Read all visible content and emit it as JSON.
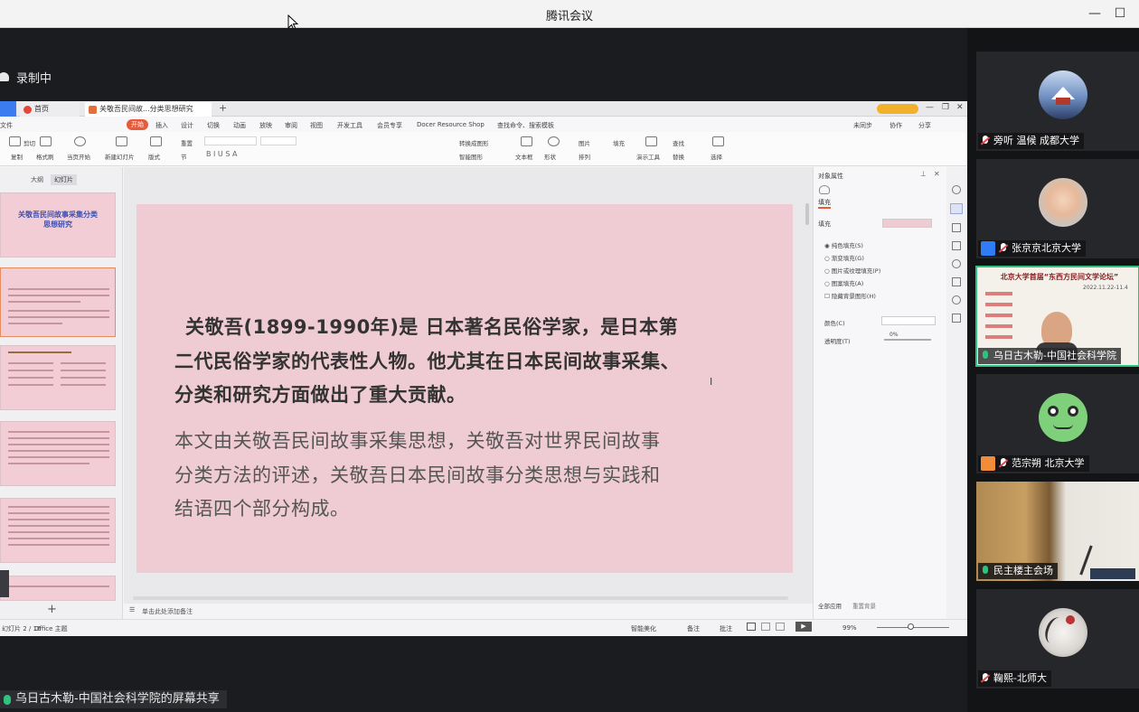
{
  "window": {
    "title": "腾讯会议",
    "minimize": "—",
    "maximize": "☐"
  },
  "recording": {
    "label": "录制中"
  },
  "wps": {
    "tabs": [
      {
        "label": "首页",
        "icon": "wps-home-icon"
      },
      {
        "label": "关敬吾民间故...分类思想研究",
        "icon": "wps-doc-icon"
      }
    ],
    "menus": [
      "文件",
      "开始",
      "插入",
      "设计",
      "切换",
      "动画",
      "放映",
      "审阅",
      "视图",
      "开发工具",
      "会员专享",
      "Docer Resource Shop",
      "查找命令、搜索模板"
    ],
    "right_menus": [
      "未同步",
      "协作",
      "分享"
    ],
    "ribbon": {
      "paste": "粘贴",
      "cut": "剪切",
      "copy": "复制",
      "format_painter": "格式刷",
      "play": "当页开始",
      "new_slide": "新建幻灯片",
      "layout": "版式",
      "section": "节",
      "reset": "重置",
      "textbox": "文本框",
      "shape": "形状",
      "arrange": "排列",
      "find": "查找",
      "replace": "替换",
      "select": "选择",
      "tools": "演示工具",
      "smart": "智能图形",
      "convert_text": "转换成图形",
      "image": "图片",
      "fill": "填充"
    },
    "panel_tabs": [
      "大纲",
      "幻灯片"
    ],
    "slide": {
      "bold_lines": [
        "关敬吾(1899-1990年)是 日本著名民俗学家，是日本第",
        "二代民俗学家的代表性人物。他尤其在日本民间故事采集、",
        "分类和研究方面做出了重大贡献。"
      ],
      "normal_lines": [
        "本文由关敬吾民间故事采集思想，关敬吾对世界民间故事",
        "分类方法的评述，关敬吾日本民间故事分类思想与实践和",
        "结语四个部分构成。"
      ]
    },
    "thumb1": {
      "title": "关敬吾民间故事采集分类思想研究"
    },
    "notes_hint": "单击此处添加备注",
    "props": {
      "header": "对象属性",
      "tab": "填充",
      "fill_label": "填充",
      "options": [
        "纯色填充(S)",
        "渐变填充(G)",
        "图片或纹理填充(P)",
        "图案填充(A)",
        "隐藏背景图形(H)"
      ],
      "color_label": "颜色(C)",
      "transparency_label": "透明度(T)",
      "transparency_value": "0%",
      "apply_all": "全部应用",
      "reset_bg": "重置背景"
    },
    "status": {
      "slide_pos": "幻灯片 2 / 16",
      "theme": "Office 主题",
      "beautify": "智能美化",
      "notes": "备注",
      "comments": "批注",
      "zoom": "99%"
    }
  },
  "share_label": "乌日古木勒-中国社会科学院的屏幕共享",
  "participants": [
    {
      "name": "旁听 温候 成都大学",
      "muted": true,
      "badge": false
    },
    {
      "name": "张京京北京大学",
      "muted": true,
      "badge": true
    },
    {
      "name": "乌日古木勒-中国社会科学院",
      "muted": false,
      "badge": false,
      "speaking": true
    },
    {
      "name": "范宗朔 北京大学",
      "muted": true,
      "badge": true
    },
    {
      "name": "民主楼主会场",
      "muted": false,
      "badge": false
    },
    {
      "name": "鞠熙-北师大",
      "muted": true,
      "badge": false
    }
  ],
  "video_tile": {
    "banner": "北京大学首届“东西方民间文学论坛”",
    "date": "2022.11.22-11.4"
  },
  "colors": {
    "accent": "#2ec27e",
    "slide_bg": "#efcbd3",
    "badge_blue": "#2f7cf6",
    "badge_orange": "#f08c3a"
  }
}
